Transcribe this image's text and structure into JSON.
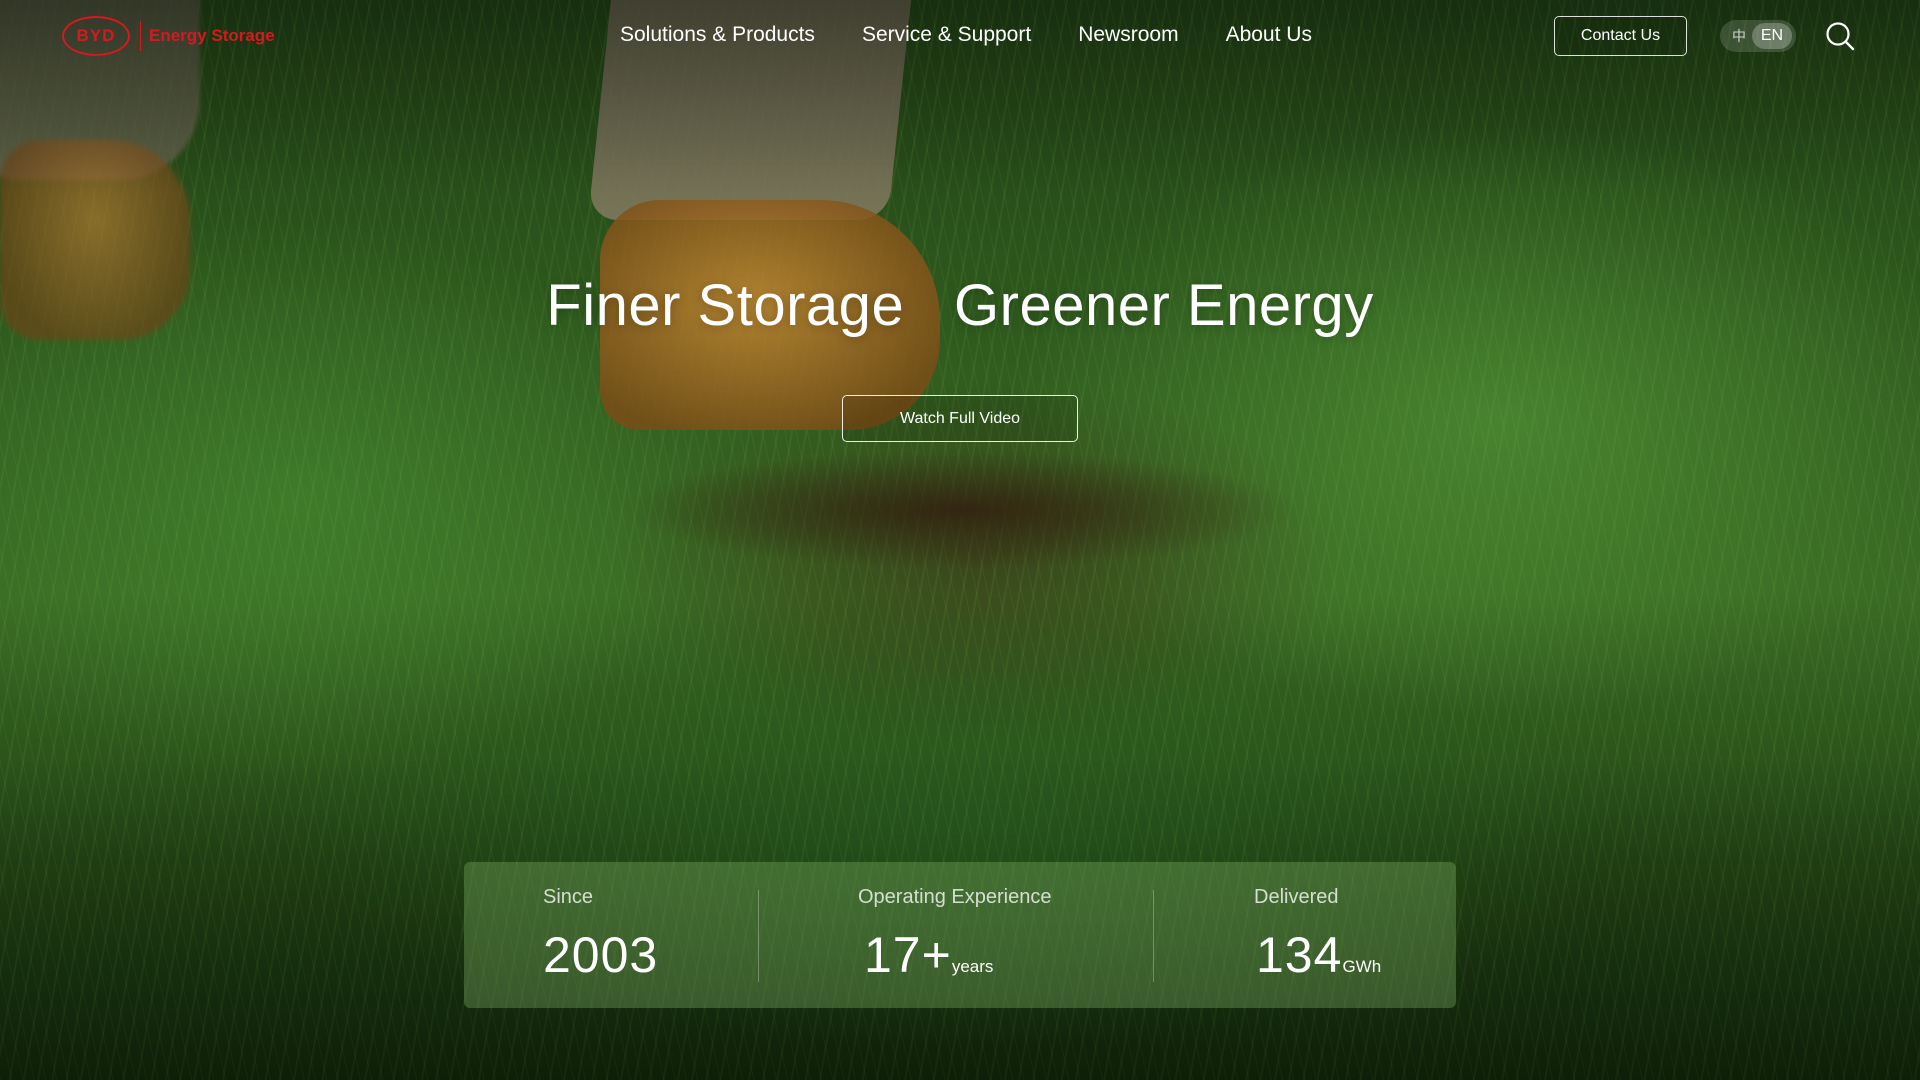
{
  "header": {
    "logo": {
      "mark": "BYD",
      "text": "Energy Storage",
      "brand_color": "#d8181f"
    },
    "nav": [
      {
        "label": "Solutions & Products"
      },
      {
        "label": "Service & Support"
      },
      {
        "label": "Newsroom"
      },
      {
        "label": "About Us"
      }
    ],
    "contact_label": "Contact Us",
    "language": {
      "zh": "中",
      "en": "EN",
      "selected": "EN"
    },
    "search_icon": "search-icon"
  },
  "hero": {
    "headline": "Finer Storage   Greener Energy",
    "watch_label": "Watch Full Video"
  },
  "stats": [
    {
      "label": "Since",
      "value": "2003",
      "unit": ""
    },
    {
      "label": "Operating Experience",
      "value": "17+",
      "unit": "years"
    },
    {
      "label": "Delivered",
      "value": "134",
      "unit": "GWh"
    }
  ]
}
